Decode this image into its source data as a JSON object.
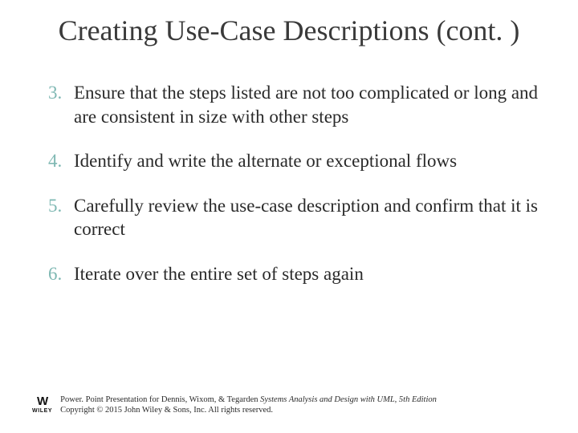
{
  "title": "Creating Use-Case Descriptions (cont. )",
  "steps": [
    {
      "n": "3.",
      "text": "Ensure that the steps listed are not too complicated or long and are consistent in size with other steps"
    },
    {
      "n": "4.",
      "text": "Identify and write the alternate or exceptional flows"
    },
    {
      "n": "5.",
      "text": "Carefully review the use-case description and confirm that it is correct"
    },
    {
      "n": "6.",
      "text": "Iterate over the entire set of steps again"
    }
  ],
  "footer": {
    "logo_mark": "W",
    "logo_text": "WILEY",
    "line1_prefix": "Power. Point Presentation for Dennis, Wixom, & Tegarden ",
    "line1_book": "Systems Analysis and Design with UML, 5th Edition",
    "line2": "Copyright © 2015 John Wiley & Sons, Inc. All rights reserved."
  }
}
